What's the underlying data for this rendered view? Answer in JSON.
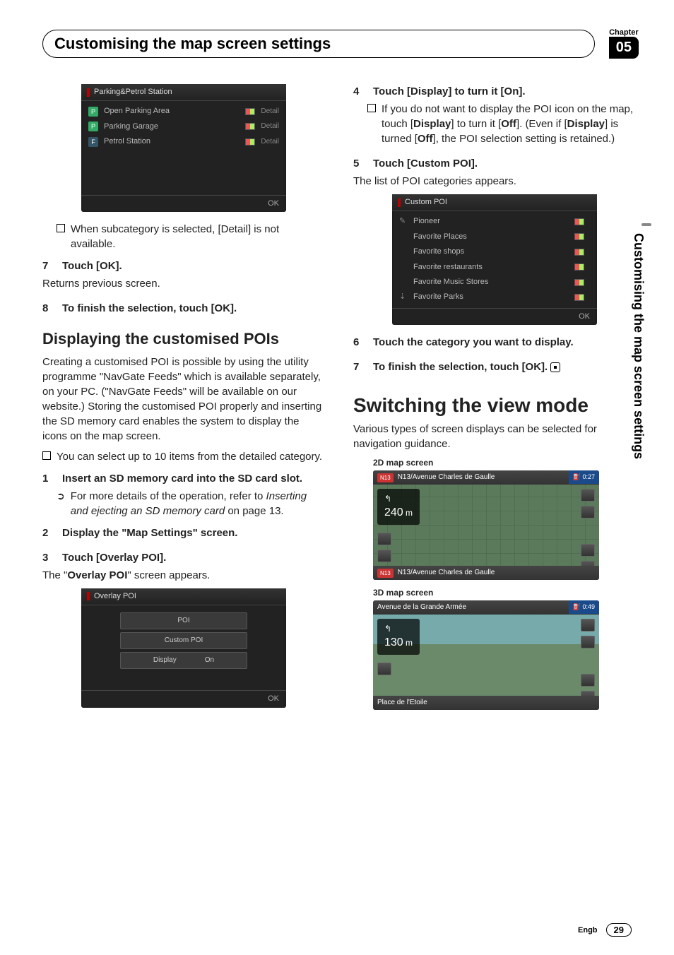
{
  "chapter": {
    "label": "Chapter",
    "number": "05"
  },
  "title": "Customising the map screen settings",
  "sideTab": "Customising the map screen settings",
  "footer": {
    "lang": "Engb",
    "page": "29"
  },
  "col1": {
    "shot1": {
      "title": "Parking&Petrol Station",
      "rows": [
        {
          "icon": "P",
          "name": "Open Parking Area",
          "detail": "Detail"
        },
        {
          "icon": "P",
          "name": "Parking Garage",
          "detail": "Detail"
        },
        {
          "icon": "F",
          "name": "Petrol Station",
          "detail": "Detail"
        }
      ],
      "ok": "OK"
    },
    "note1": "When subcategory is selected, [Detail] is not available.",
    "step7": {
      "n": "7",
      "t": "Touch [OK]."
    },
    "step7sub": "Returns previous screen.",
    "step8": {
      "n": "8",
      "t": "To finish the selection, touch [OK]."
    },
    "h2": "Displaying the customised POIs",
    "para1": "Creating a customised POI is possible by using the utility programme \"NavGate Feeds\" which is available separately, on your PC. (\"NavGate Feeds\" will be available on our website.) Storing the customised POI properly and inserting the SD memory card enables the system to display the icons on the map screen.",
    "bullet1": "You can select up to 10 items from the detailed category.",
    "step1": {
      "n": "1",
      "t": "Insert an SD memory card into the SD card slot."
    },
    "ref1a": "For more details of the operation, refer to ",
    "ref1b": "Inserting and ejecting an SD memory card",
    "ref1c": " on page 13.",
    "step2": {
      "n": "2",
      "t": "Display the \"Map Settings\" screen."
    },
    "step3": {
      "n": "3",
      "t": "Touch [Overlay POI]."
    },
    "step3sub_a": "The \"",
    "step3sub_b": "Overlay POI",
    "step3sub_c": "\" screen appears.",
    "shot2": {
      "title": "Overlay POI",
      "btn1": "POI",
      "btn2": "Custom POI",
      "btn3": "Display",
      "on": "On",
      "ok": "OK"
    }
  },
  "col2": {
    "step4": {
      "n": "4",
      "t": "Touch [Display] to turn it [On]."
    },
    "s4b_a": "If you do not want to display the POI icon on the map, touch [",
    "s4b_b": "Display",
    "s4b_c": "] to turn it [",
    "s4b_d": "Off",
    "s4b_e": "]. (Even if [",
    "s4b_f": "Display",
    "s4b_g": "] is turned [",
    "s4b_h": "Off",
    "s4b_i": "], the POI selection setting is retained.)",
    "step5": {
      "n": "5",
      "t": "Touch [Custom POI]."
    },
    "step5sub": "The list of POI categories appears.",
    "shot3": {
      "title": "Custom POI",
      "rows": [
        "Pioneer",
        "Favorite Places",
        "Favorite shops",
        "Favorite restaurants",
        "Favorite Music Stores",
        "Favorite Parks"
      ],
      "ok": "OK"
    },
    "step6": {
      "n": "6",
      "t": "Touch the category you want to display."
    },
    "step7": {
      "n": "7",
      "t": "To finish the selection, touch [OK]."
    },
    "h1": "Switching the view mode",
    "para": "Various types of screen displays can be selected for navigation guidance.",
    "cap1": "2D map screen",
    "map1": {
      "badge": "N13",
      "street": "N13/Avenue Charles de Gaulle",
      "time": "0:27",
      "dist": "240",
      "unit": "m",
      "botBadge": "N13",
      "botStreet": "N13/Avenue Charles de Gaulle"
    },
    "cap2": "3D map screen",
    "map2": {
      "street": "Avenue de la Grande Armée",
      "time": "0:49",
      "dist": "130",
      "unit": "m",
      "botStreet": "Place de l'Etoile"
    }
  }
}
